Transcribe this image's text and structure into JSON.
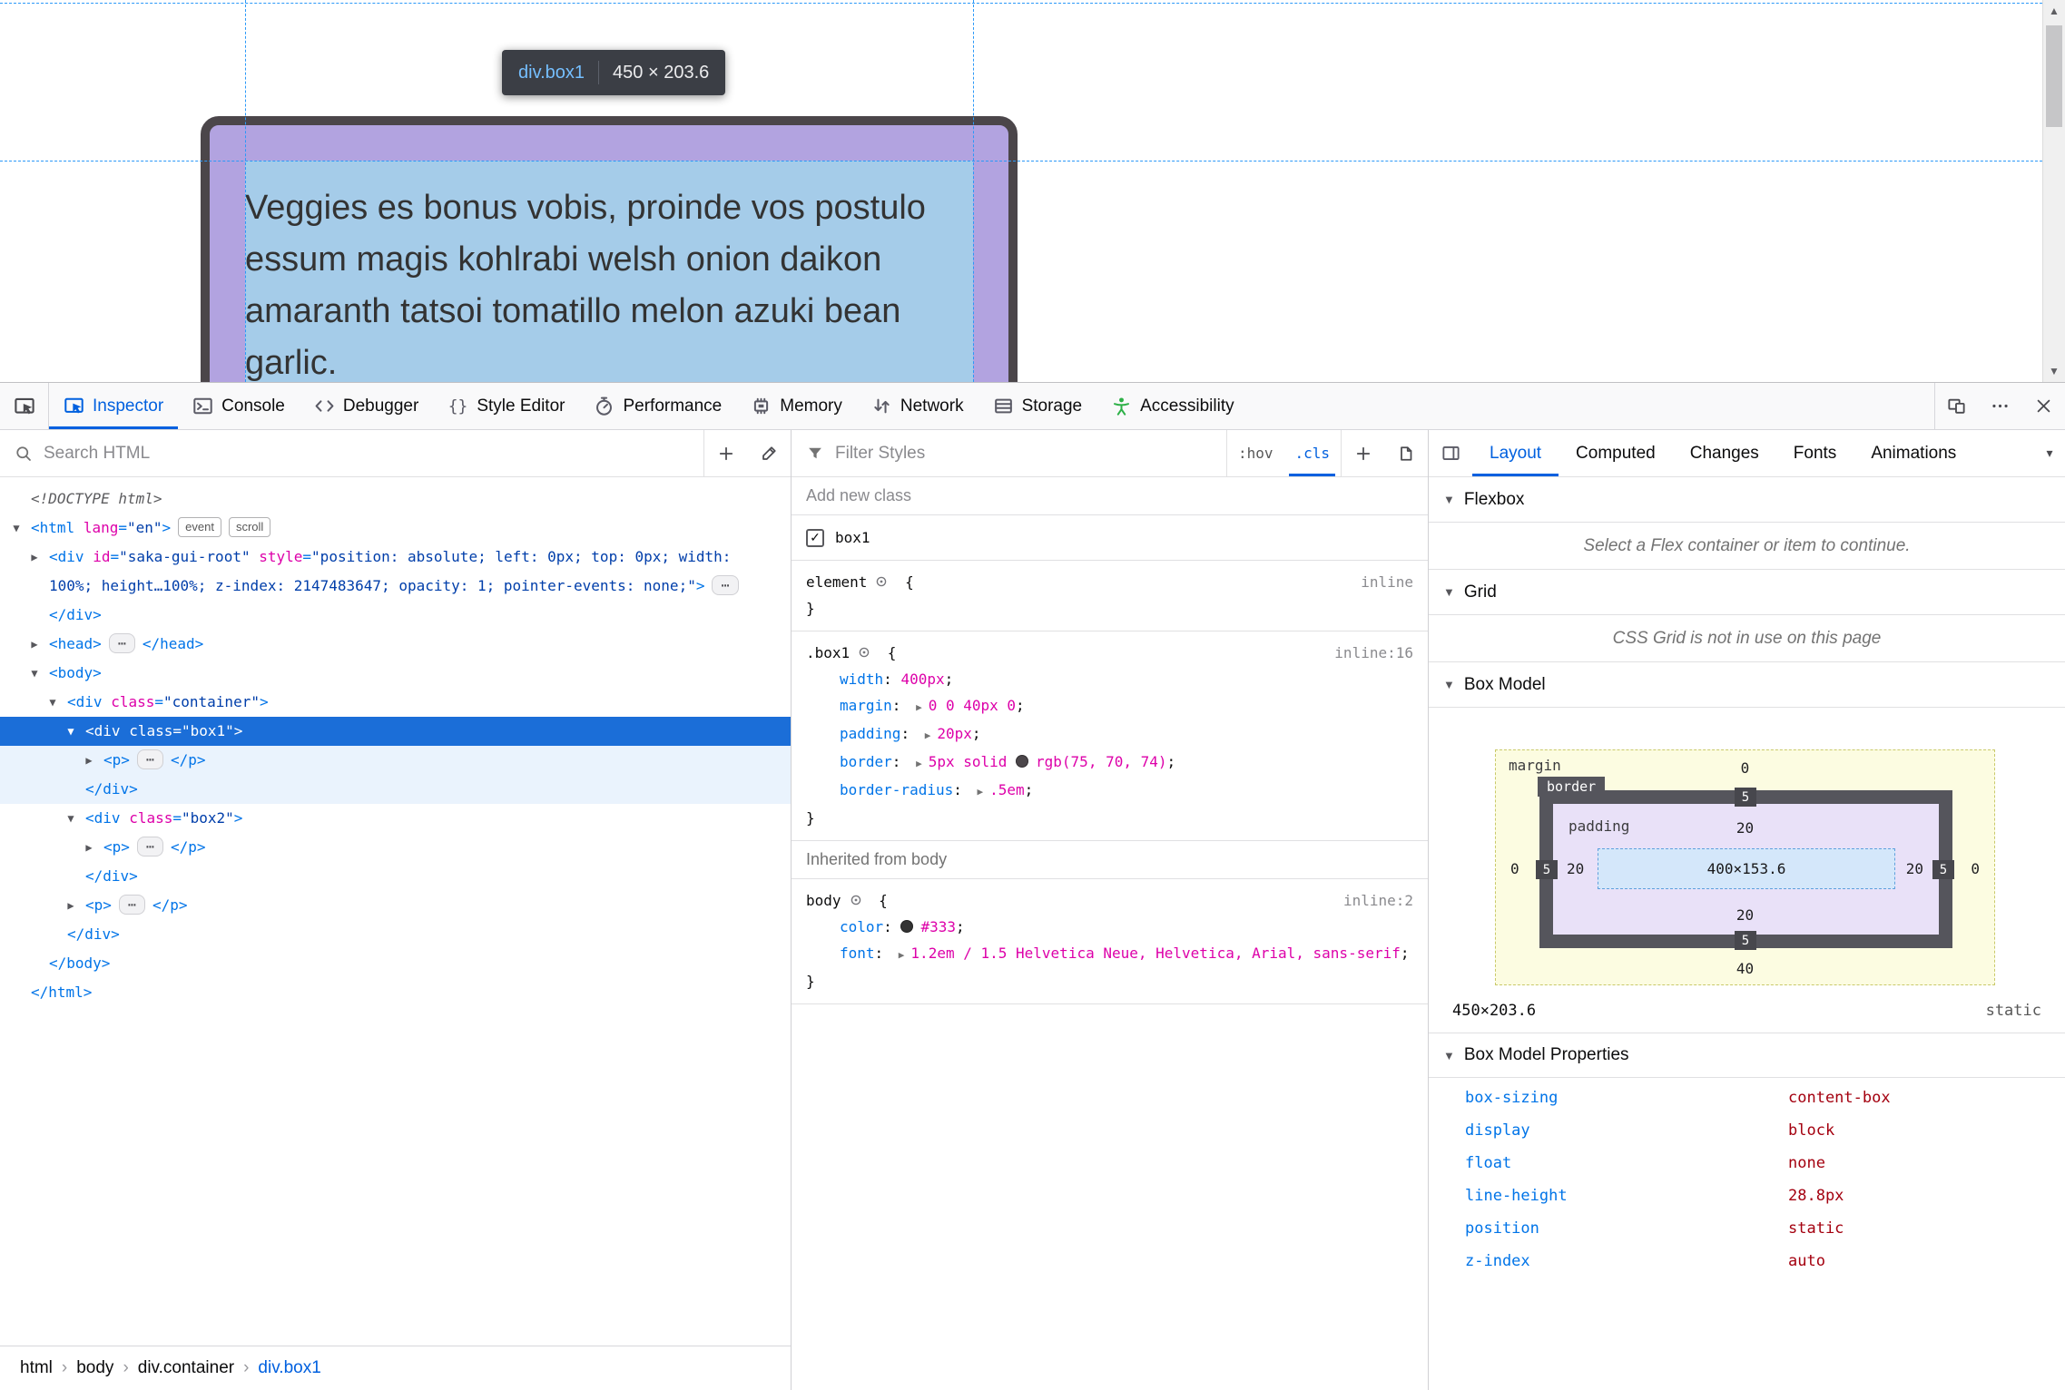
{
  "theme": {
    "accent_blue": "#0060df",
    "selection_blue": "#1b6ed8",
    "tag_blue": "#0074e8",
    "attr_magenta": "#dd00a9",
    "attr_value_navy": "#003eaa",
    "css_property_blue": "#0074e8",
    "css_value_magenta": "#dd00a9",
    "layout_value_red": "#a4000f",
    "a11y_green": "#2db047",
    "guide_blue": "#2b99f8",
    "highlight_content_blue": "#a5cce9",
    "highlight_padding_purple": "#b2a3e0",
    "element_border_color": "#4b464a"
  },
  "page": {
    "tooltip": {
      "tag": "div",
      "class": ".box1",
      "size": "450 × 203.6"
    },
    "content_text": "Veggies es bonus vobis, proinde vos postulo essum magis kohlrabi welsh onion daikon amaranth tatsoi tomatillo melon azuki bean garlic."
  },
  "toolbar": {
    "tabs": [
      {
        "id": "inspector",
        "label": "Inspector",
        "icon": "inspector-icon",
        "active": true
      },
      {
        "id": "console",
        "label": "Console",
        "icon": "console-icon"
      },
      {
        "id": "debugger",
        "label": "Debugger",
        "icon": "debugger-icon"
      },
      {
        "id": "style-editor",
        "label": "Style Editor",
        "icon": "braces-icon"
      },
      {
        "id": "performance",
        "label": "Performance",
        "icon": "stopwatch-icon"
      },
      {
        "id": "memory",
        "label": "Memory",
        "icon": "chip-icon"
      },
      {
        "id": "network",
        "label": "Network",
        "icon": "arrows-icon"
      },
      {
        "id": "storage",
        "label": "Storage",
        "icon": "storage-icon"
      },
      {
        "id": "accessibility",
        "label": "Accessibility",
        "icon": "accessibility-icon",
        "icon_color": "#2db047"
      }
    ],
    "window_buttons": [
      {
        "id": "responsive",
        "icon": "responsive-icon"
      },
      {
        "id": "menu",
        "icon": "meatball-icon"
      },
      {
        "id": "close",
        "icon": "close-icon"
      }
    ]
  },
  "markup": {
    "search_placeholder": "Search HTML",
    "lines": [
      {
        "indent": 0,
        "arrow": "none",
        "tokens": [
          [
            "doctype",
            "<!DOCTYPE html>"
          ]
        ]
      },
      {
        "indent": 0,
        "arrow": "open",
        "badges": [
          "event",
          "scroll"
        ],
        "tokens": [
          [
            "punc",
            "<"
          ],
          [
            "tag",
            "html"
          ],
          [
            "plain",
            " "
          ],
          [
            "attr",
            "lang"
          ],
          [
            "punc",
            "="
          ],
          [
            "val",
            "\"en\""
          ],
          [
            "punc",
            ">"
          ]
        ]
      },
      {
        "indent": 1,
        "arrow": "closed",
        "tokens": [
          [
            "punc",
            "<"
          ],
          [
            "tag",
            "div"
          ],
          [
            "plain",
            " "
          ],
          [
            "attr",
            "id"
          ],
          [
            "punc",
            "="
          ],
          [
            "val",
            "\"saka-gui-root\""
          ],
          [
            "plain",
            " "
          ],
          [
            "attr",
            "style"
          ],
          [
            "punc",
            "="
          ],
          [
            "val",
            "\"position: absolute; left: 0px; top: 0px; width: 100%; height…100%; z-index: 2147483647; opacity: 1; pointer-events: none;\""
          ],
          [
            "punc",
            ">"
          ],
          [
            "ellipsis",
            "⋯"
          ],
          [
            "punc",
            "</"
          ],
          [
            "tag",
            "div"
          ],
          [
            "punc",
            ">"
          ]
        ]
      },
      {
        "indent": 1,
        "arrow": "closed",
        "tokens": [
          [
            "punc",
            "<"
          ],
          [
            "tag",
            "head"
          ],
          [
            "punc",
            ">"
          ],
          [
            "ellipsis",
            "⋯"
          ],
          [
            "punc",
            "</"
          ],
          [
            "tag",
            "head"
          ],
          [
            "punc",
            ">"
          ]
        ]
      },
      {
        "indent": 1,
        "arrow": "open",
        "tokens": [
          [
            "punc",
            "<"
          ],
          [
            "tag",
            "body"
          ],
          [
            "punc",
            ">"
          ]
        ]
      },
      {
        "indent": 2,
        "arrow": "open",
        "tokens": [
          [
            "punc",
            "<"
          ],
          [
            "tag",
            "div"
          ],
          [
            "plain",
            " "
          ],
          [
            "attr",
            "class"
          ],
          [
            "punc",
            "="
          ],
          [
            "val",
            "\"container\""
          ],
          [
            "punc",
            ">"
          ]
        ]
      },
      {
        "indent": 3,
        "arrow": "open",
        "state": "selected",
        "tokens": [
          [
            "punc",
            "<"
          ],
          [
            "tag",
            "div"
          ],
          [
            "plain",
            " "
          ],
          [
            "attr",
            "class"
          ],
          [
            "punc",
            "="
          ],
          [
            "val",
            "\"box1\""
          ],
          [
            "punc",
            ">"
          ]
        ]
      },
      {
        "indent": 4,
        "arrow": "closed",
        "state": "shade",
        "tokens": [
          [
            "punc",
            "<"
          ],
          [
            "tag",
            "p"
          ],
          [
            "punc",
            ">"
          ],
          [
            "ellipsis",
            "⋯"
          ],
          [
            "punc",
            "</"
          ],
          [
            "tag",
            "p"
          ],
          [
            "punc",
            ">"
          ]
        ]
      },
      {
        "indent": 3,
        "arrow": "none",
        "state": "shade",
        "tokens": [
          [
            "punc",
            "</"
          ],
          [
            "tag",
            "div"
          ],
          [
            "punc",
            ">"
          ]
        ]
      },
      {
        "indent": 3,
        "arrow": "open",
        "tokens": [
          [
            "punc",
            "<"
          ],
          [
            "tag",
            "div"
          ],
          [
            "plain",
            " "
          ],
          [
            "attr",
            "class"
          ],
          [
            "punc",
            "="
          ],
          [
            "val",
            "\"box2\""
          ],
          [
            "punc",
            ">"
          ]
        ]
      },
      {
        "indent": 4,
        "arrow": "closed",
        "tokens": [
          [
            "punc",
            "<"
          ],
          [
            "tag",
            "p"
          ],
          [
            "punc",
            ">"
          ],
          [
            "ellipsis",
            "⋯"
          ],
          [
            "punc",
            "</"
          ],
          [
            "tag",
            "p"
          ],
          [
            "punc",
            ">"
          ]
        ]
      },
      {
        "indent": 3,
        "arrow": "none",
        "tokens": [
          [
            "punc",
            "</"
          ],
          [
            "tag",
            "div"
          ],
          [
            "punc",
            ">"
          ]
        ]
      },
      {
        "indent": 3,
        "arrow": "closed",
        "tokens": [
          [
            "punc",
            "<"
          ],
          [
            "tag",
            "p"
          ],
          [
            "punc",
            ">"
          ],
          [
            "ellipsis",
            "⋯"
          ],
          [
            "punc",
            "</"
          ],
          [
            "tag",
            "p"
          ],
          [
            "punc",
            ">"
          ]
        ]
      },
      {
        "indent": 2,
        "arrow": "none",
        "tokens": [
          [
            "punc",
            "</"
          ],
          [
            "tag",
            "div"
          ],
          [
            "punc",
            ">"
          ]
        ]
      },
      {
        "indent": 1,
        "arrow": "none",
        "tokens": [
          [
            "punc",
            "</"
          ],
          [
            "tag",
            "body"
          ],
          [
            "punc",
            ">"
          ]
        ]
      },
      {
        "indent": 0,
        "arrow": "none",
        "tokens": [
          [
            "punc",
            "</"
          ],
          [
            "tag",
            "html"
          ],
          [
            "punc",
            ">"
          ]
        ]
      }
    ],
    "breadcrumbs": [
      {
        "label": "html"
      },
      {
        "label": "body"
      },
      {
        "label": "div.container"
      },
      {
        "label": "div.box1",
        "active": true
      }
    ]
  },
  "rules": {
    "filter_placeholder": "Filter Styles",
    "controls": {
      "hov": ":hov",
      "cls": ".cls"
    },
    "add_class_placeholder": "Add new class",
    "class_toggle": {
      "checked": true,
      "label": "box1"
    },
    "sections": [
      {
        "type": "rule",
        "selector": "element",
        "link": "inline",
        "decls": []
      },
      {
        "type": "rule",
        "selector": ".box1",
        "link": "inline:16",
        "decls": [
          {
            "name": "width",
            "value_parts": [
              {
                "text": "400px"
              }
            ]
          },
          {
            "name": "margin",
            "expand": true,
            "value_parts": [
              {
                "text": "0 0 40px 0"
              }
            ]
          },
          {
            "name": "padding",
            "expand": true,
            "value_parts": [
              {
                "text": "20px"
              }
            ]
          },
          {
            "name": "border",
            "expand": true,
            "value_parts": [
              {
                "text": "5px solid "
              },
              {
                "swatch": "#4b464a"
              },
              {
                "text": "rgb(75, 70, 74)"
              }
            ]
          },
          {
            "name": "border-radius",
            "expand": true,
            "value_parts": [
              {
                "text": ".5em"
              }
            ]
          }
        ]
      },
      {
        "type": "header",
        "text": "Inherited from body"
      },
      {
        "type": "rule",
        "selector": "body",
        "link": "inline:2",
        "decls": [
          {
            "name": "color",
            "value_parts": [
              {
                "swatch": "#333333"
              },
              {
                "text": "#333"
              }
            ]
          },
          {
            "name": "font",
            "expand": true,
            "value_parts": [
              {
                "text": "1.2em / 1.5 Helvetica Neue, Helvetica, Arial, sans-serif"
              }
            ]
          }
        ]
      }
    ]
  },
  "layout": {
    "tabs": [
      {
        "label": "Layout",
        "active": true
      },
      {
        "label": "Computed"
      },
      {
        "label": "Changes"
      },
      {
        "label": "Fonts"
      },
      {
        "label": "Animations"
      }
    ],
    "sections": {
      "flexbox": {
        "title": "Flexbox",
        "message": "Select a Flex container or item to continue."
      },
      "grid": {
        "title": "Grid",
        "message": "CSS Grid is not in use on this page"
      },
      "box_model": {
        "title": "Box Model",
        "labels": {
          "margin": "margin",
          "border": "border",
          "padding": "padding"
        },
        "margin": {
          "top": "0",
          "right": "0",
          "bottom": "40",
          "left": "0"
        },
        "border": {
          "top": "5",
          "right": "5",
          "bottom": "5",
          "left": "5"
        },
        "padding": {
          "top": "20",
          "right": "20",
          "bottom": "20",
          "left": "20"
        },
        "content": "400×153.6",
        "dimensions": "450×203.6",
        "position": "static"
      },
      "properties": {
        "title": "Box Model Properties",
        "items": [
          {
            "name": "box-sizing",
            "value": "content-box"
          },
          {
            "name": "display",
            "value": "block"
          },
          {
            "name": "float",
            "value": "none"
          },
          {
            "name": "line-height",
            "value": "28.8px"
          },
          {
            "name": "position",
            "value": "static"
          },
          {
            "name": "z-index",
            "value": "auto"
          }
        ]
      }
    }
  }
}
